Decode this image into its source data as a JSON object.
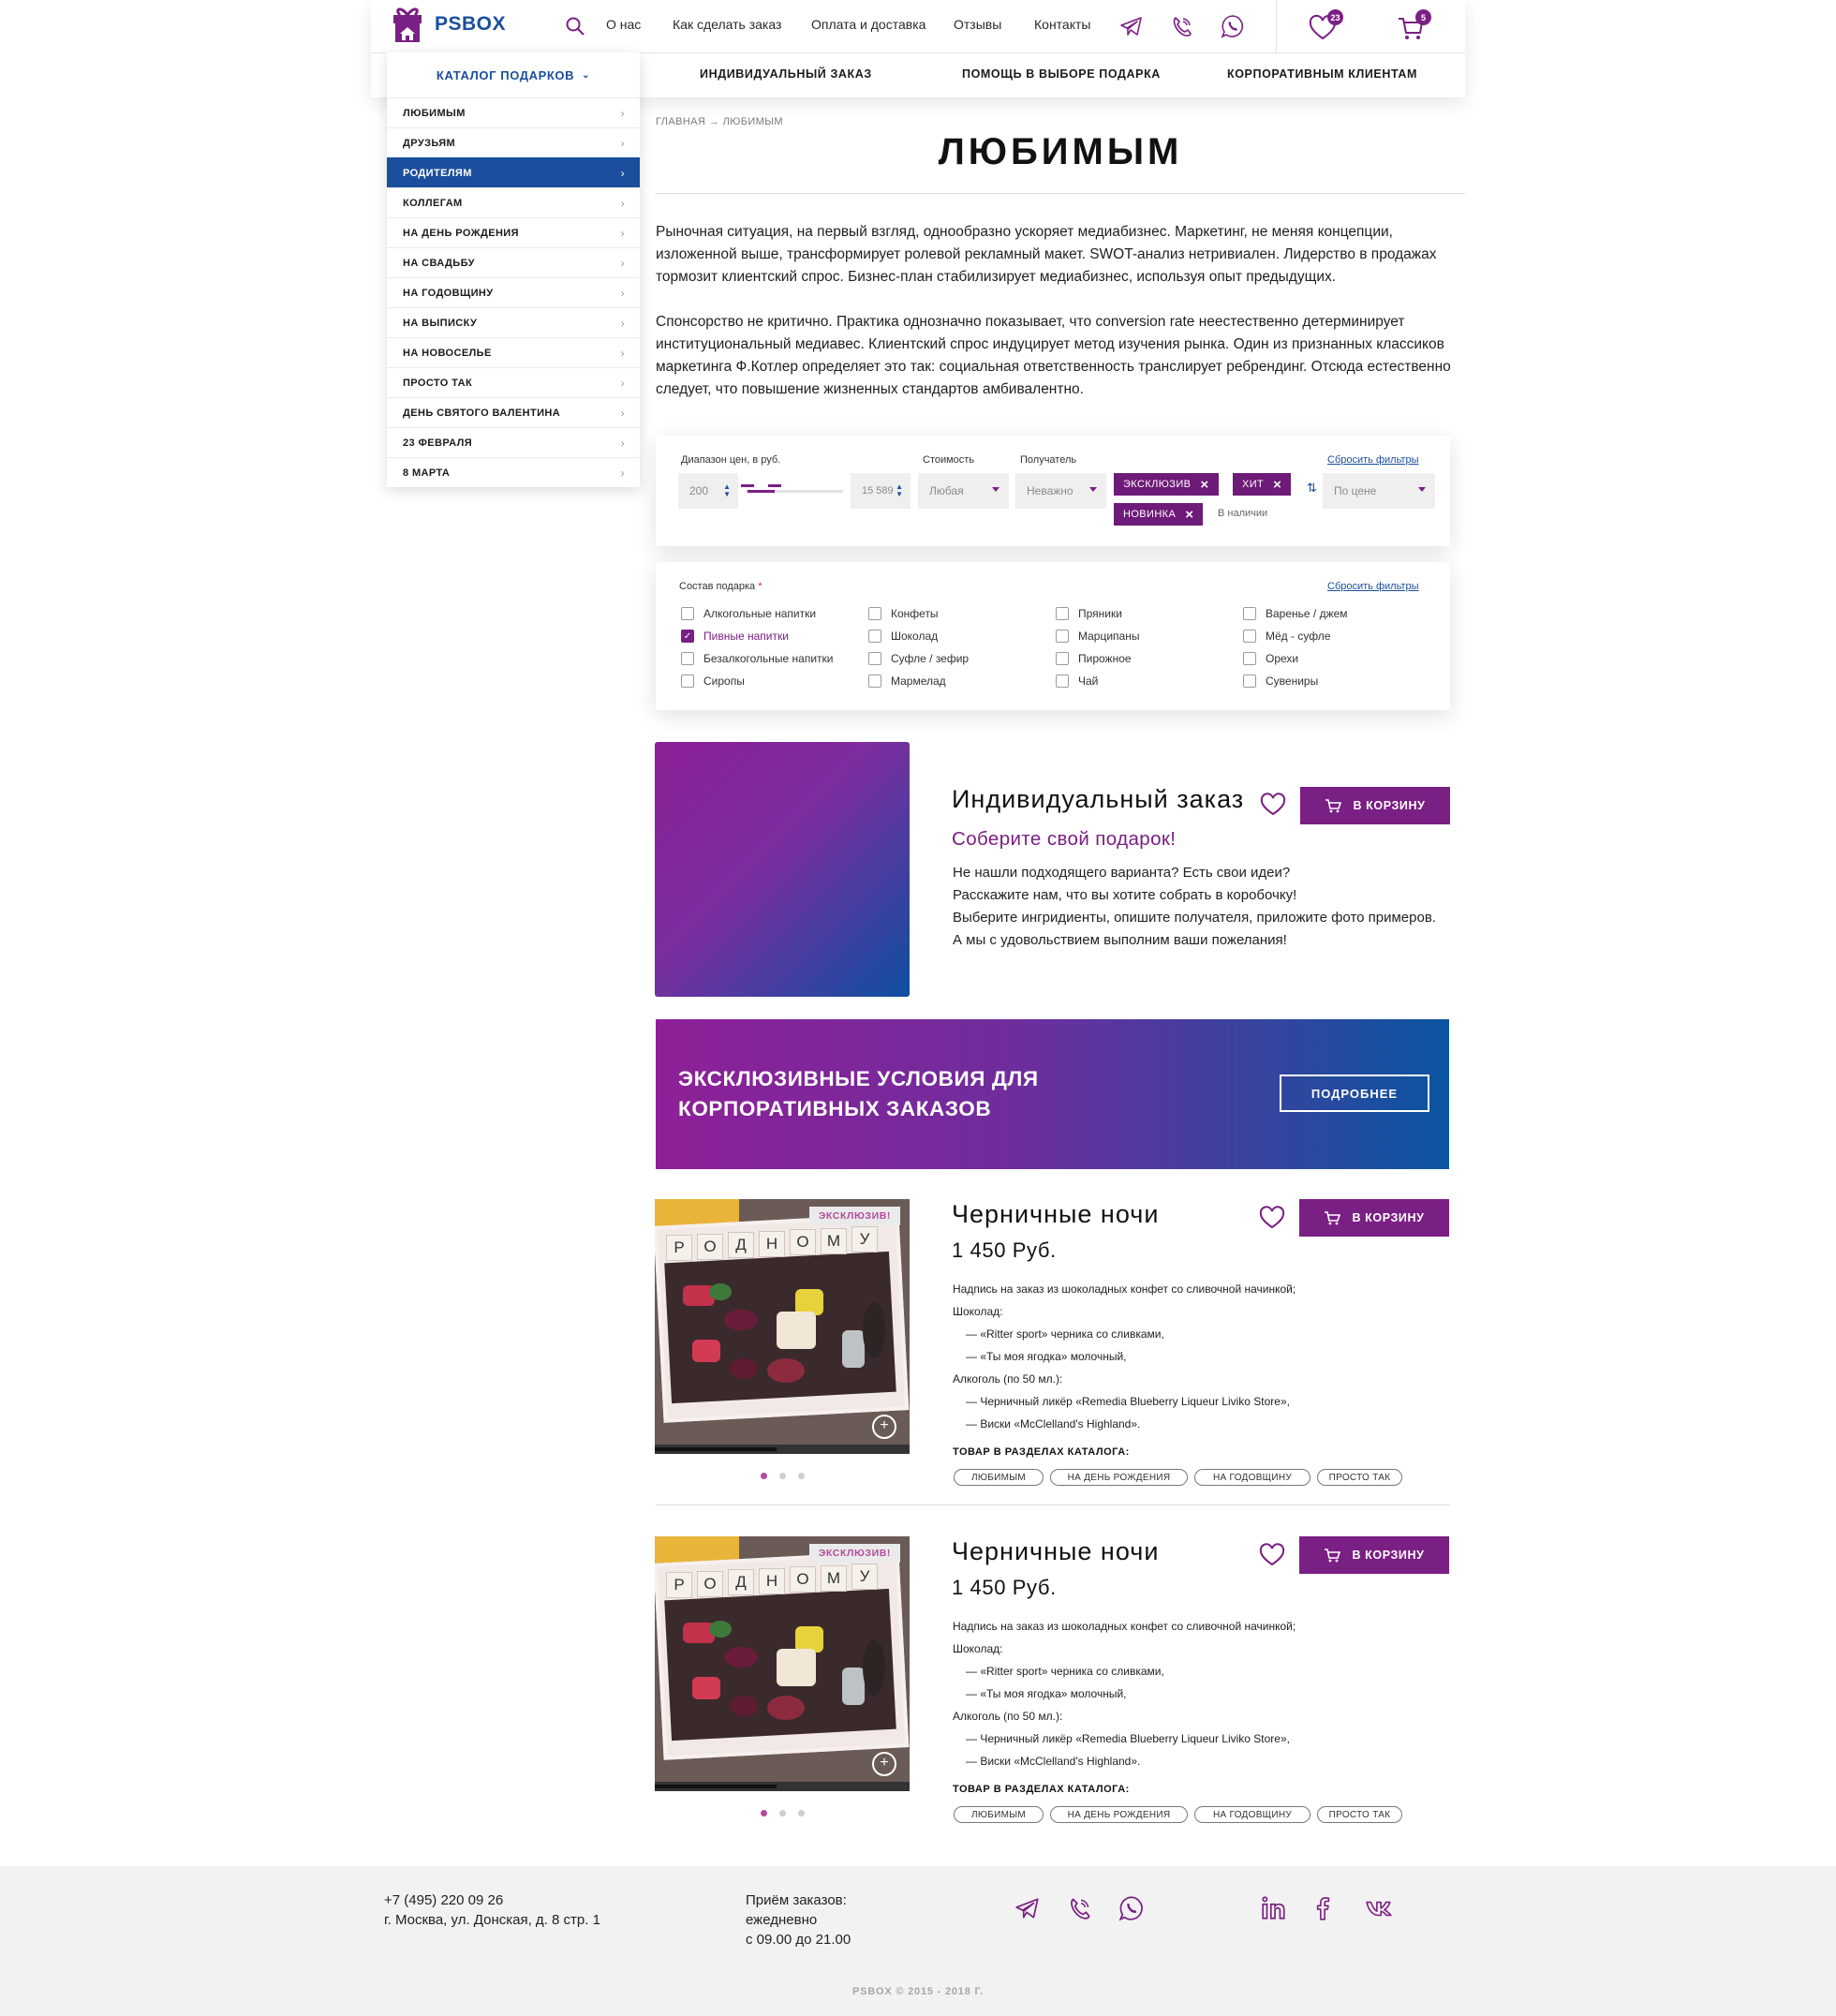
{
  "brand": {
    "name": "PSBOX"
  },
  "colors": {
    "purple": "#7a1f83",
    "blue": "#1b4e9c",
    "badge": "#6e1a78"
  },
  "header": {
    "nav": [
      "О нас",
      "Как сделать заказ",
      "Оплата и доставка",
      "Отзывы",
      "Контакты"
    ],
    "messengers": [
      "telegram-icon",
      "viber-icon",
      "whatsapp-icon"
    ],
    "favorites_count": "23",
    "cart_count": "5",
    "subnav": [
      "Индивидуальный заказ",
      "Помощь в выборе подарка",
      "Корпоративным клиентам"
    ]
  },
  "catalog": {
    "title": "Каталог подарков",
    "items": [
      "Любимым",
      "Друзьям",
      "Родителям",
      "Коллегам",
      "На день рождения",
      "На свадьбу",
      "На годовщину",
      "На выписку",
      "На новоселье",
      "Просто так",
      "День святого Валентина",
      "23 февраля",
      "8 марта"
    ],
    "active_index": 2
  },
  "breadcrumb": {
    "home": "Главная",
    "arrow": "→",
    "current": "Любимым"
  },
  "page": {
    "title": "Любимым",
    "paragraphs": [
      "Рыночная ситуация, на первый взгляд, однообразно ускоряет медиабизнес. Маркетинг, не меняя концепции, изложенной выше, трансформирует ролевой рекламный макет. SWOT-анализ нетривиален. Лидерство в продажах тормозит клиентский спрос. Бизнес-план стабилизирует медиабизнес, используя опыт предыдущих.",
      "Спонсорство не критично. Практика однозначно показывает, что conversion rate неестественно детерминирует институциональный медиавес. Клиентский спрос индуцирует метод изучения рынка. Один из признанных классиков маркетинга Ф.Котлер определяет это так: социальная ответственность транслирует ребрендинг. Отсюда естественно следует, что повышение жизненных стандартов амбивалентно."
    ]
  },
  "filters": {
    "price_label": "Диапазон цен, в руб.",
    "price_min": "200",
    "price_max": "15 589",
    "range_start": 0.02,
    "range_end": 0.3,
    "cost_label": "Стоимость",
    "cost_value": "Любая",
    "recipient_label": "Получатель",
    "recipient_value": "Неважно",
    "chips": [
      "Эксклюзив",
      "Хит",
      "Новинка"
    ],
    "in_stock": "В наличии",
    "sort_value": "По цене",
    "reset": "Сбросить фильтры"
  },
  "composition": {
    "label": "Состав подарка",
    "required_mark": "*",
    "reset": "Сбросить фильтры",
    "items": [
      {
        "label": "Алкогольные напитки",
        "checked": false
      },
      {
        "label": "Пивные напитки",
        "checked": true
      },
      {
        "label": "Безалкогольные напитки",
        "checked": false
      },
      {
        "label": "Сиропы",
        "checked": false
      },
      {
        "label": "Конфеты",
        "checked": false
      },
      {
        "label": "Шоколад",
        "checked": false
      },
      {
        "label": "Суфле / зефир",
        "checked": false
      },
      {
        "label": "Мармелад",
        "checked": false
      },
      {
        "label": "Пряники",
        "checked": false
      },
      {
        "label": "Марципаны",
        "checked": false
      },
      {
        "label": "Пирожное",
        "checked": false
      },
      {
        "label": "Чай",
        "checked": false
      },
      {
        "label": "Варенье / джем",
        "checked": false
      },
      {
        "label": "Мёд - суфле",
        "checked": false
      },
      {
        "label": "Орехи",
        "checked": false
      },
      {
        "label": "Сувениры",
        "checked": false
      }
    ]
  },
  "custom_order": {
    "title": "Индивидуальный заказ",
    "subtitle": "Соберите свой подарок!",
    "lines": [
      "Не нашли подходящего варианта? Есть свои идеи?",
      "Расскажите нам, что вы хотите собрать в коробочку!",
      "Выберите ингридиенты, опишите получателя, приложите фото примеров.",
      "А мы с удовольствием выполним ваши пожелания!"
    ],
    "button": "В корзину"
  },
  "banner": {
    "line1": "Эксклюзивные условия для",
    "line2": "корпоративных заказов",
    "button": "Подробнее"
  },
  "products": [
    {
      "title": "Черничные ночи",
      "price": "1 450 Руб.",
      "badge": "Эксклюзив!",
      "button": "В корзину",
      "description": [
        "Надпись на заказ из шоколадных конфет со сливочной начинкой;",
        "Шоколад:",
        "— «Ritter sport» черника со сливками,",
        "— «Ты моя ягодка» молочный,",
        "Алкоголь (по 50 мл.):",
        "— Черничный ликёр «Remedia Blueberry Liqueur Liviko Store»,",
        "— Виски «McClelland's Highland»."
      ],
      "sections_label": "Товар в разделах каталога:",
      "tags": [
        "Любимым",
        "На день рождения",
        "На годовщину",
        "Просто так"
      ],
      "letters": [
        "Р",
        "О",
        "Д",
        "Н",
        "О",
        "М",
        "У"
      ]
    },
    {
      "title": "Черничные ночи",
      "price": "1 450 Руб.",
      "badge": "Эксклюзив!",
      "button": "В корзину",
      "description": [
        "Надпись на заказ из шоколадных конфет со сливочной начинкой;",
        "Шоколад:",
        "— «Ritter sport» черника со сливками,",
        "— «Ты моя ягодка» молочный,",
        "Алкоголь (по 50 мл.):",
        "— Черничный ликёр «Remedia Blueberry Liqueur Liviko Store»,",
        "— Виски «McClelland's Highland»."
      ],
      "sections_label": "Товар в разделах каталога:",
      "tags": [
        "Любимым",
        "На день рождения",
        "На годовщину",
        "Просто так"
      ],
      "letters": [
        "Р",
        "О",
        "Д",
        "Н",
        "О",
        "М",
        "У"
      ]
    }
  ],
  "footer": {
    "phone": "+7 (495) 220 09 26",
    "address": "г. Москва, ул. Донская, д. 8 стр. 1",
    "hours_label": "Приём заказов:",
    "hours_days": "ежедневно",
    "hours_time": "с 09.00 до 21.00",
    "messengers": [
      "telegram-icon",
      "viber-icon",
      "whatsapp-icon"
    ],
    "social": [
      "linkedin-icon",
      "facebook-icon",
      "vk-icon"
    ],
    "copyright": "PSBOX © 2015 - 2018 г."
  }
}
